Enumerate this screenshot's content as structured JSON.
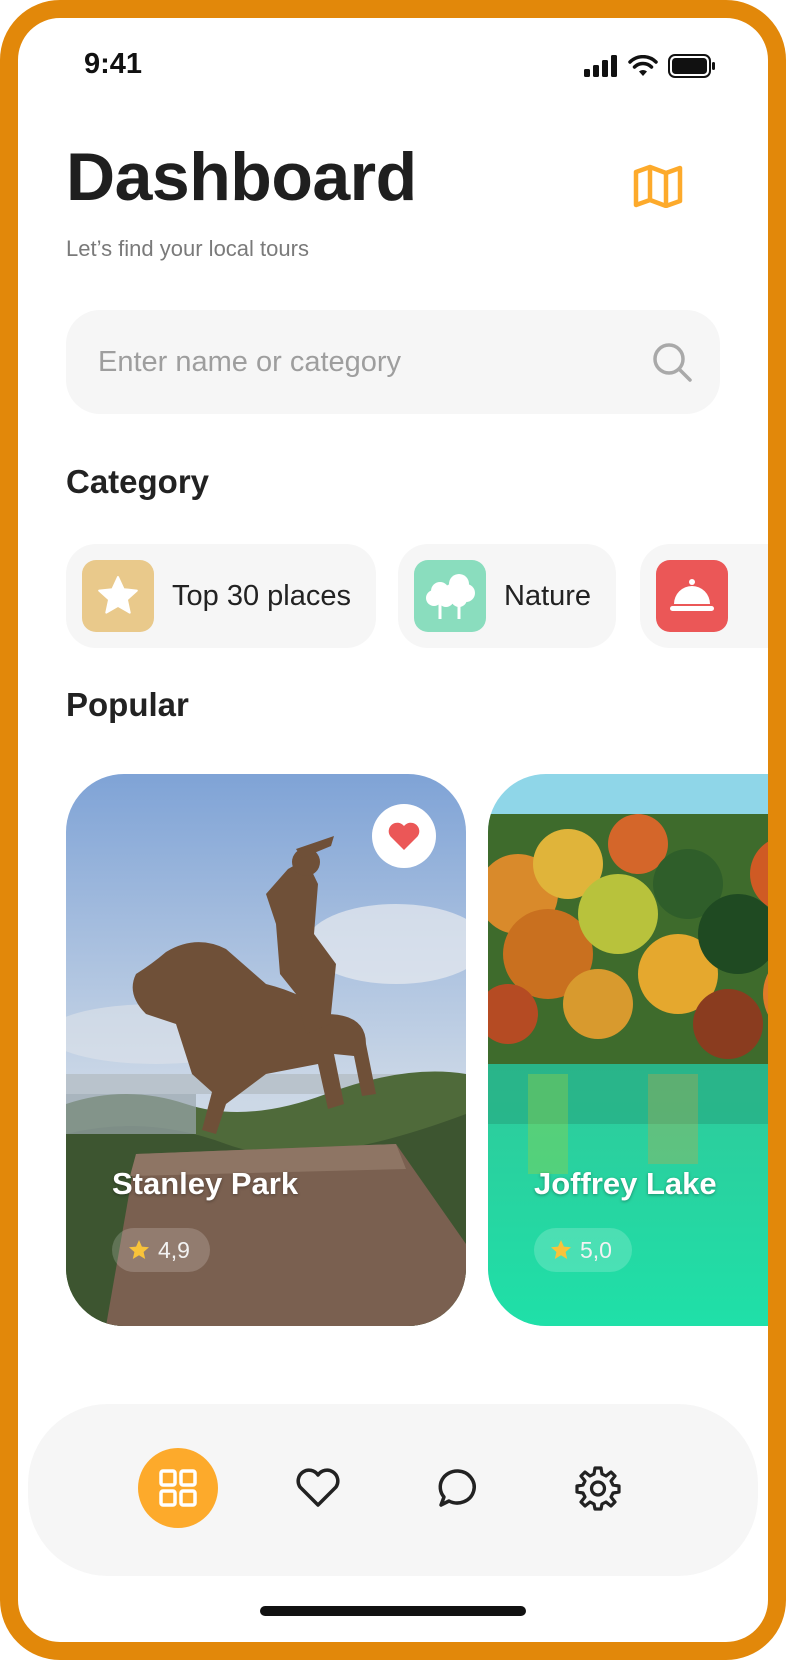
{
  "status_bar": {
    "time": "9:41"
  },
  "header": {
    "title": "Dashboard",
    "subtitle": "Let’s find your local tours",
    "map_icon": "map-icon"
  },
  "search": {
    "placeholder": "Enter name or category",
    "value": "",
    "icon": "search-icon"
  },
  "categories": {
    "title": "Category",
    "items": [
      {
        "label": "Top 30 places",
        "icon": "star-icon",
        "color": "#E9C98B"
      },
      {
        "label": "Nature",
        "icon": "trees-icon",
        "color": "#8ADDBE"
      },
      {
        "label": "",
        "icon": "food-cloche-icon",
        "color": "#EB5757"
      }
    ]
  },
  "popular": {
    "title": "Popular",
    "items": [
      {
        "name": "Stanley Park",
        "rating": "4,9",
        "favorite": true
      },
      {
        "name": "Joffrey Lake",
        "rating": "5,0",
        "favorite": false
      }
    ]
  },
  "bottom_nav": {
    "items": [
      {
        "icon": "grid-icon",
        "active": true
      },
      {
        "icon": "heart-icon",
        "active": false
      },
      {
        "icon": "chat-icon",
        "active": false
      },
      {
        "icon": "gear-icon",
        "active": false
      }
    ],
    "accent_color": "#FDAA2B"
  },
  "colors": {
    "frame": "#E2880A",
    "accent": "#FDAA2B",
    "favorite": "#EB5757",
    "star": "#F8C33A"
  }
}
